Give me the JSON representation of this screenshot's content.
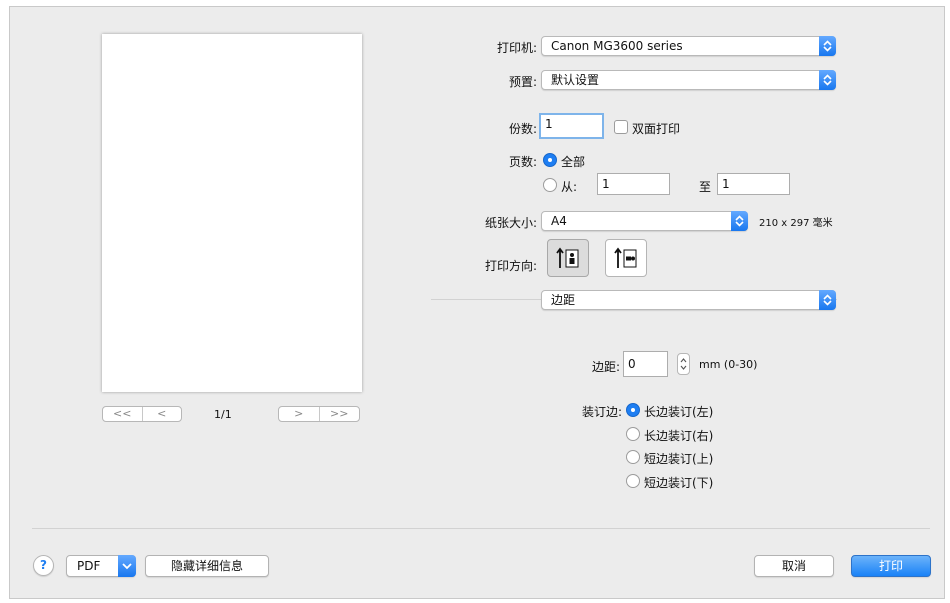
{
  "print": {
    "printer_label": "打印机:",
    "printer_value": "Canon MG3600 series",
    "presets_label": "预置:",
    "presets_value": "默认设置",
    "copies_label": "份数:",
    "copies_value": "1",
    "two_sided_label": "双面打印",
    "pages_label": "页数:",
    "pages_all": "全部",
    "pages_from_label": "从:",
    "pages_from_value": "1",
    "pages_to_label": "至",
    "pages_to_value": "1",
    "paper_size_label": "纸张大小:",
    "paper_size_value": "A4",
    "paper_size_dims": "210 x 297 毫米",
    "orientation_label": "打印方向:",
    "section_value": "边距"
  },
  "margin": {
    "label": "边距:",
    "value": "0",
    "unit": "mm (0-30)"
  },
  "binding": {
    "label": "装订边:",
    "options": [
      "长边装订(左)",
      "长边装订(右)",
      "短边装订(上)",
      "短边装订(下)"
    ],
    "selected_index": 0
  },
  "preview": {
    "page_indicator": "1/1",
    "first_glyph": "<<",
    "prev_glyph": "<",
    "next_glyph": ">",
    "last_glyph": ">>"
  },
  "bottom": {
    "help_glyph": "?",
    "pdf_label": "PDF",
    "hide_details_label": "隐藏详细信息",
    "cancel_label": "取消",
    "print_label": "打印"
  },
  "colors": {
    "accent": "#1e7ef2",
    "dialog_bg": "#ececec"
  },
  "icons": [
    "updown-arrows-icon",
    "chevron-down-icon",
    "portrait-orientation-icon",
    "landscape-orientation-icon",
    "help-icon"
  ]
}
